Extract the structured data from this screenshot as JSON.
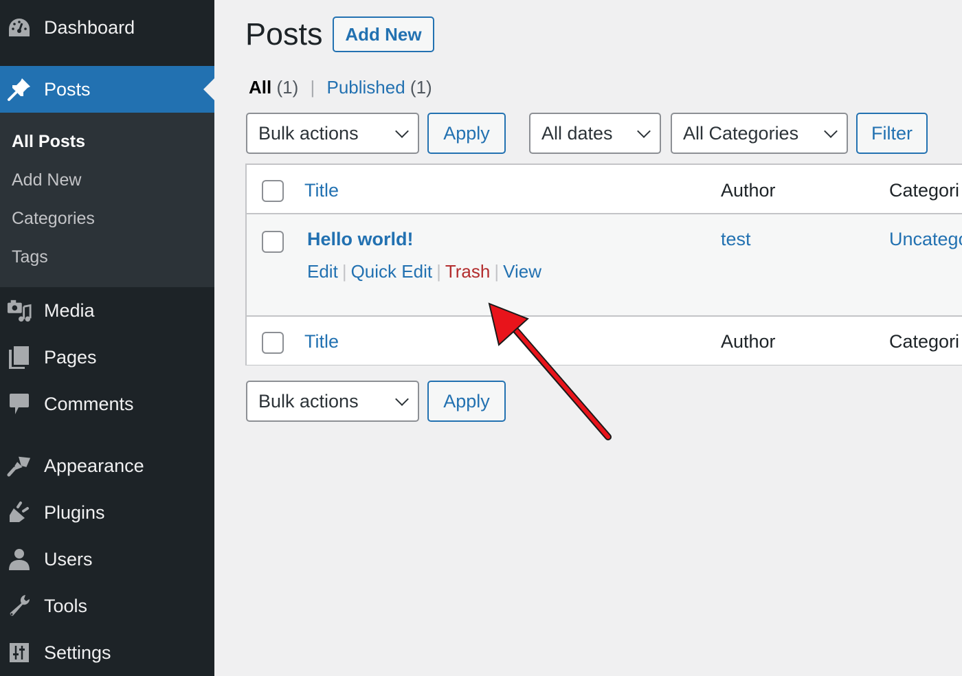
{
  "sidebar": {
    "items": [
      {
        "label": "Dashboard",
        "icon": "dashboard-icon"
      },
      {
        "label": "Posts",
        "icon": "pin-icon",
        "active": true
      },
      {
        "label": "Media",
        "icon": "media-icon"
      },
      {
        "label": "Pages",
        "icon": "pages-icon"
      },
      {
        "label": "Comments",
        "icon": "comment-icon"
      },
      {
        "label": "Appearance",
        "icon": "paintbrush-icon"
      },
      {
        "label": "Plugins",
        "icon": "plug-icon"
      },
      {
        "label": "Users",
        "icon": "user-icon"
      },
      {
        "label": "Tools",
        "icon": "wrench-icon"
      },
      {
        "label": "Settings",
        "icon": "settings-icon"
      }
    ],
    "submenu": [
      {
        "label": "All Posts",
        "current": true
      },
      {
        "label": "Add New"
      },
      {
        "label": "Categories"
      },
      {
        "label": "Tags"
      }
    ]
  },
  "header": {
    "title": "Posts",
    "add_new_label": "Add New"
  },
  "views": {
    "all_label": "All",
    "all_count": "(1)",
    "separator": "|",
    "published_label": "Published",
    "published_count": "(1)"
  },
  "filters": {
    "bulk_actions": "Bulk actions",
    "apply_label": "Apply",
    "dates": "All dates",
    "categories": "All Categories",
    "filter_label": "Filter"
  },
  "table": {
    "columns": [
      "Title",
      "Author",
      "Categori"
    ],
    "rows": [
      {
        "title": "Hello world!",
        "author": "test",
        "category": "Uncatego",
        "actions": [
          "Edit",
          "Quick Edit",
          "Trash",
          "View"
        ]
      }
    ]
  },
  "colors": {
    "accent": "#2271b1",
    "sidebar_bg": "#1d2327",
    "trash": "#b32d2e",
    "annotation_arrow": "#e8141b"
  }
}
